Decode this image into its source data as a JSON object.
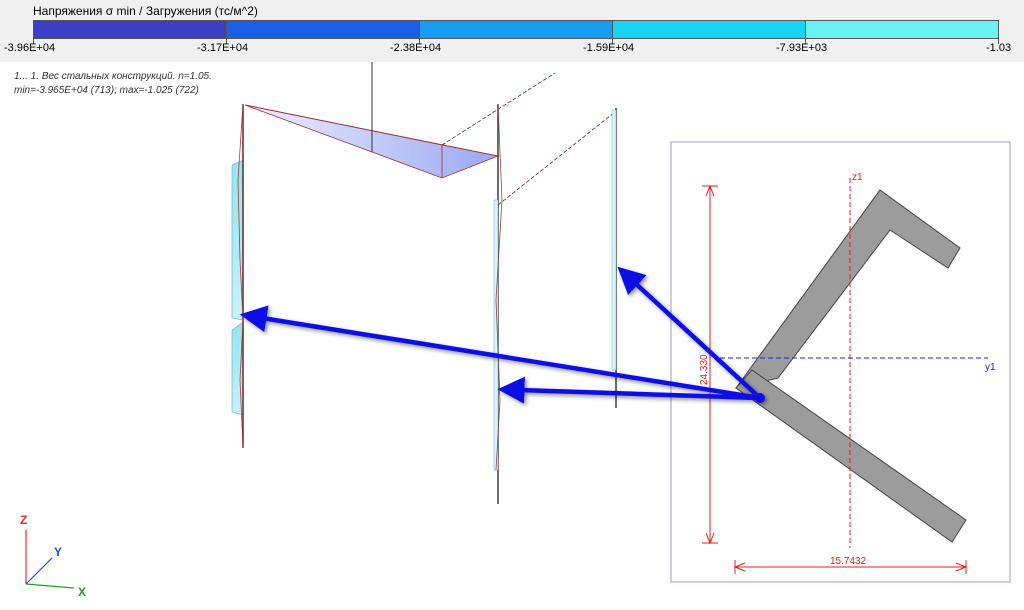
{
  "legend": {
    "title": "Напряжения σ min / Загружения (тс/м^2)",
    "colors": [
      "#3b3fc4",
      "#1a5fe6",
      "#1a9df0",
      "#16d6f4",
      "#6bf0f4"
    ],
    "ticks": [
      "-3.96E+04",
      "-3.17E+04",
      "-2.38E+04",
      "-1.59E+04",
      "-7.93E+03",
      "-1.03"
    ]
  },
  "info": {
    "line1": "1... 1. Вес стальных конструкций. n=1.05.",
    "line2": "min=-3.965E+04 (713); max=-1.025 (722)"
  },
  "section": {
    "dim_vertical": "24.330",
    "dim_horizontal": "15.7432",
    "axis_z": "z1",
    "axis_y": "y1",
    "fill_color": "#9c9c9c",
    "dim_color": "#e02020",
    "axis_color": "#2020e0"
  },
  "triad": {
    "z": "Z",
    "y": "Y",
    "x": "X"
  },
  "annotation_color": "#0a0ae6"
}
